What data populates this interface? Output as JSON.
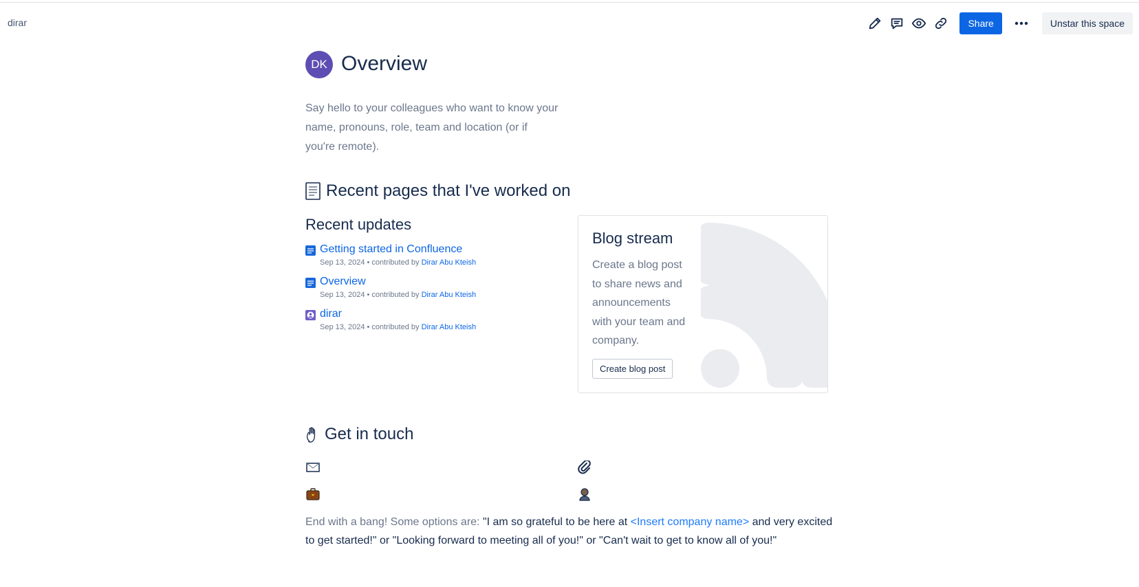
{
  "breadcrumb": "dirar",
  "toolbar": {
    "icons": [
      "edit-icon",
      "comment-icon",
      "watch-icon",
      "link-icon",
      "more-icon"
    ],
    "share_label": "Share",
    "unstar_label": "Unstar this space"
  },
  "page": {
    "avatar_initials": "DK",
    "title": "Overview",
    "intro": "Say hello to your colleagues who want to know your name, pronouns, role, team and location (or if you're remote)."
  },
  "recent_section": {
    "heading": "Recent pages that I've worked on",
    "icon": "page-emoji-icon"
  },
  "recent_updates": {
    "title": "Recent updates",
    "items": [
      {
        "title": "Getting started in Confluence",
        "meta": "Sep 13, 2024 • contributed by",
        "author": "Dirar Abu Kteish",
        "icon": "page-icon"
      },
      {
        "title": "Overview",
        "meta": "Sep 13, 2024 • contributed by",
        "author": "Dirar Abu Kteish",
        "icon": "page-icon"
      },
      {
        "title": "dirar",
        "meta": "Sep 13, 2024 • contributed by",
        "author": "Dirar Abu Kteish",
        "icon": "space-icon"
      }
    ]
  },
  "blog_stream": {
    "title": "Blog stream",
    "description": "Create a blog post to share news and announcements with your team and company.",
    "button_label": "Create blog post",
    "background_icon": "rss-icon"
  },
  "get_in_touch": {
    "heading": "Get in touch",
    "icon": "waving-hand-icon",
    "contact_icons": [
      "email-icon",
      "paperclip-icon",
      "briefcase-icon",
      "person-icon"
    ]
  },
  "closing": {
    "prefix": "End with a bang! Some options are: ",
    "quote_start": "\"I am so grateful to be here at ",
    "company_placeholder": "<Insert company name>",
    "quote_end": " and very excited to get started!\" or \"Looking forward to meeting all of you!\" or \"Can't wait to get to know all of you!\""
  },
  "colors": {
    "accent": "#0c66e4",
    "avatar": "#5e4db2",
    "text": "#172b4d",
    "subtle_text": "#6b778c"
  }
}
